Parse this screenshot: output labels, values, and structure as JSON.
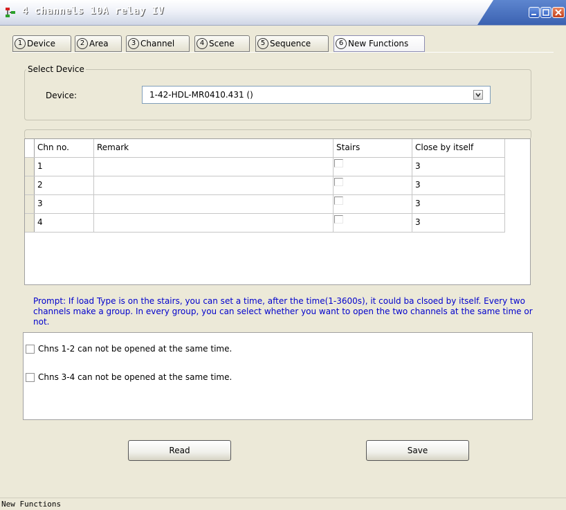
{
  "window": {
    "title": "4 channels 10A relay IV"
  },
  "tabs": [
    {
      "num": "1",
      "label": "Device"
    },
    {
      "num": "2",
      "label": "Area"
    },
    {
      "num": "3",
      "label": "Channel"
    },
    {
      "num": "4",
      "label": "Scene"
    },
    {
      "num": "5",
      "label": "Sequence"
    },
    {
      "num": "6",
      "label": "New Functions",
      "active": true
    }
  ],
  "select_device": {
    "group_title": "Select Device",
    "label": "Device:",
    "value": "1-42-HDL-MR0410.431 ()"
  },
  "grid": {
    "columns": [
      "Chn no.",
      "Remark",
      "Stairs",
      "Close by itself"
    ],
    "rows": [
      {
        "chn": "1",
        "remark": "",
        "stairs": false,
        "close": "3"
      },
      {
        "chn": "2",
        "remark": "",
        "stairs": false,
        "close": "3"
      },
      {
        "chn": "3",
        "remark": "",
        "stairs": false,
        "close": "3"
      },
      {
        "chn": "4",
        "remark": "",
        "stairs": false,
        "close": "3"
      }
    ]
  },
  "prompt": "Prompt: If load Type is on the stairs, you can set a time, after the time(1-3600s), it could ba clsoed by itself. Every two channels make a group. In every group, you can select whether you want to open the two channels at the same time or not.",
  "options": [
    {
      "label": "Chns 1-2 can not be opened at the same time.",
      "checked": false
    },
    {
      "label": "Chns 3-4 can not be opened at the same time.",
      "checked": false
    }
  ],
  "buttons": {
    "read": "Read",
    "save": "Save"
  },
  "status": "New Functions",
  "colors": {
    "titlebar_accent": "#3b62b1",
    "prompt_text": "#0000cc",
    "dialog_bg": "#ece9d8"
  }
}
